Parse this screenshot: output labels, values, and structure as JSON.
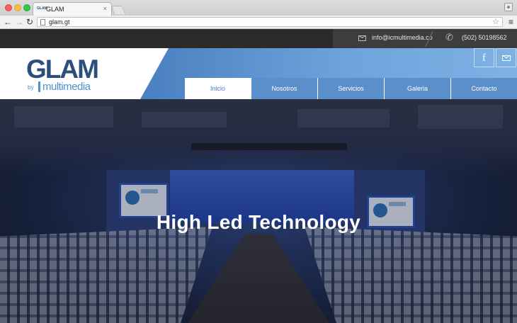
{
  "browser": {
    "tab_title": "GLAM",
    "tab_favicon": "GLAM",
    "tab_close": "×",
    "url": "glam.gt"
  },
  "icons": {
    "back": "←",
    "forward": "→",
    "reload": "↻",
    "star": "☆",
    "menu": "≡",
    "phone": "✆",
    "facebook": "f"
  },
  "topbar": {
    "email": "info@icmultimedia.co",
    "phone": "(502) 50198562"
  },
  "logo": {
    "name": "GLAM",
    "by": "by",
    "company": "multimedia"
  },
  "nav": {
    "items": [
      "Inicio",
      "Nosotros",
      "Servicios",
      "Galeria",
      "Contacto"
    ],
    "active": "Inicio"
  },
  "hero": {
    "title": "High Led Technology"
  },
  "colors": {
    "brand_dark": "#2b4e7d",
    "brand_blue": "#4c8fd4",
    "nav_blue": "#5b8fcb",
    "topbar": "#2b2b2b"
  }
}
